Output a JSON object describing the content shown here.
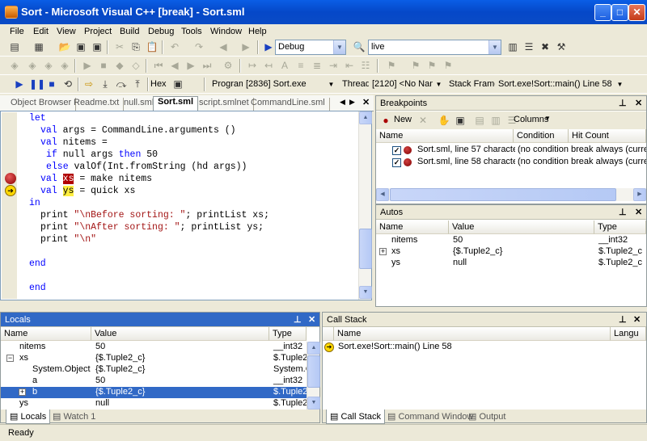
{
  "window": {
    "title": "Sort - Microsoft Visual C++ [break] - Sort.sml"
  },
  "menu": [
    "File",
    "Edit",
    "View",
    "Project",
    "Build",
    "Debug",
    "Tools",
    "Window",
    "Help"
  ],
  "toolbar": {
    "config": "Debug",
    "find": "live",
    "hex_label": "Hex",
    "program_label": "Program",
    "program_value": "[2836] Sort.exe",
    "thread_label": "Thread",
    "thread_value": "[2120] <No Name>",
    "frame_label": "Stack Frame",
    "frame_value": "Sort.exe!Sort::main() Line 58"
  },
  "editor_tabs": [
    "Object Browser",
    "Readme.txt",
    "null.sml",
    "Sort.sml",
    "script.smlnet",
    "CommandLine.sml"
  ],
  "active_editor_tab": "Sort.sml",
  "code": {
    "l1": "let",
    "l2a": "val",
    "l2b": " args = CommandLine.arguments ()",
    "l3a": "val",
    "l3b": " nitems =",
    "l4a": "if",
    "l4b": " null args ",
    "l4c": "then",
    "l4d": " 50",
    "l5a": "else",
    "l5b": " valOf(Int.fromString (hd args))",
    "l6a": "val",
    "l6b": " ",
    "l6c": "xs",
    "l6d": " = make nitems",
    "l7a": "val",
    "l7b": " ",
    "l7c": "ys",
    "l7d": " = quick xs",
    "l8": "in",
    "l9a": "print ",
    "l9b": "\"\\nBefore sorting: \"",
    "l9c": "; printList xs;",
    "l10a": "print ",
    "l10b": "\"\\nAfter sorting: \"",
    "l10c": "; printList ys;",
    "l11a": "print ",
    "l11b": "\"\\n\"",
    "l12": "end",
    "l13": "end"
  },
  "breakpoints": {
    "title": "Breakpoints",
    "new_label": "New",
    "columns_label": "Columns",
    "headers": [
      "Name",
      "Condition",
      "Hit Count"
    ],
    "rows": [
      {
        "name": "Sort.sml, line 57 character 7",
        "condition": "(no condition)",
        "hits": "break always (curren"
      },
      {
        "name": "Sort.sml, line 58 character 7",
        "condition": "(no condition)",
        "hits": "break always (curren"
      }
    ]
  },
  "autos": {
    "title": "Autos",
    "headers": [
      "Name",
      "Value",
      "Type"
    ],
    "rows": [
      {
        "name": "nitems",
        "value": "50",
        "type": "__int32"
      },
      {
        "name": "xs",
        "value": "{$.Tuple2_c}",
        "type": "$.Tuple2_c"
      },
      {
        "name": "ys",
        "value": "null",
        "type": "$.Tuple2_c"
      }
    ]
  },
  "locals": {
    "title": "Locals",
    "headers": [
      "Name",
      "Value",
      "Type"
    ],
    "rows": [
      {
        "name": "nitems",
        "value": "50",
        "type": "__int32"
      },
      {
        "name": "xs",
        "value": "{$.Tuple2_c}",
        "type": "$.Tuple2_"
      },
      {
        "name": "System.Object",
        "value": "{$.Tuple2_c}",
        "type": "System.C"
      },
      {
        "name": "a",
        "value": "50",
        "type": "__int32"
      },
      {
        "name": "b",
        "value": "{$.Tuple2_c}",
        "type": "$.Tuple2_"
      },
      {
        "name": "ys",
        "value": "null",
        "type": "$.Tuple2_"
      }
    ],
    "tabs": [
      "Locals",
      "Watch 1"
    ]
  },
  "callstack": {
    "title": "Call Stack",
    "headers": [
      "Name",
      "Langu"
    ],
    "rows": [
      {
        "name": "Sort.exe!Sort::main() Line 58"
      }
    ],
    "tabs": [
      "Call Stack",
      "Command Window",
      "Output"
    ]
  },
  "status": "Ready",
  "colors": {
    "titlebar": "#0a4bc6",
    "selection": "#3169c6",
    "breakpoint": "#b00000",
    "current_line": "#ffef40"
  }
}
